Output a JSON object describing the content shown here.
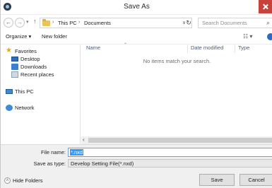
{
  "window": {
    "title": "Save As"
  },
  "address": {
    "crumbs": [
      "This PC",
      "Documents"
    ],
    "search_placeholder": "Search Documents"
  },
  "toolbar": {
    "organize_label": "Organize ▾",
    "new_folder_label": "New folder"
  },
  "nav": {
    "favorites": "Favorites",
    "desktop": "Desktop",
    "downloads": "Downloads",
    "recent": "Recent places",
    "this_pc": "This PC",
    "network": "Network"
  },
  "list": {
    "columns": [
      "Name",
      "Date modified",
      "Type"
    ],
    "empty_message": "No items match your search."
  },
  "form": {
    "file_name_label": "File name:",
    "file_name_value": "*.nxd",
    "save_as_type_label": "Save as type:",
    "save_as_type_value": "Develop Setting File(*.nxd)"
  },
  "footer": {
    "hide_folders": "Hide Folders",
    "save_label": "Save",
    "cancel_label": "Cancel"
  }
}
